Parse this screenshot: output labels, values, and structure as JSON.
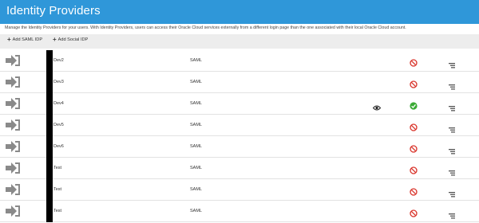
{
  "header": {
    "title": "Identity Providers"
  },
  "description": "Manage the Identity Providers for your users. With Identity Providers, users can access their Oracle Cloud services externally from a different login page than the one associated with their local Oracle Cloud account.",
  "toolbar": {
    "add_saml_label": "Add SAML IDP",
    "add_social_label": "Add Social IDP"
  },
  "colors": {
    "header": "#2f97d9",
    "disabled": "#d9342b",
    "enabled": "#3aaa35"
  },
  "providers": [
    {
      "name": "Dev2",
      "type": "SAML",
      "status": "disabled",
      "status_icon": "disabled-icon",
      "visible_icon": false
    },
    {
      "name": "Dev3",
      "type": "SAML",
      "status": "disabled",
      "status_icon": "disabled-icon",
      "visible_icon": false
    },
    {
      "name": "Dev4",
      "type": "SAML",
      "status": "enabled",
      "status_icon": "check-icon",
      "visible_icon": true
    },
    {
      "name": "Dev5",
      "type": "SAML",
      "status": "disabled",
      "status_icon": "disabled-icon",
      "visible_icon": false
    },
    {
      "name": "Dev6",
      "type": "SAML",
      "status": "disabled",
      "status_icon": "disabled-icon",
      "visible_icon": false
    },
    {
      "name": "Test",
      "type": "SAML",
      "status": "disabled",
      "status_icon": "disabled-icon",
      "visible_icon": false
    },
    {
      "name": "Test",
      "type": "SAML",
      "status": "disabled",
      "status_icon": "disabled-icon",
      "visible_icon": false
    },
    {
      "name": "Test",
      "type": "SAML",
      "status": "disabled",
      "status_icon": "disabled-icon",
      "visible_icon": false
    }
  ]
}
